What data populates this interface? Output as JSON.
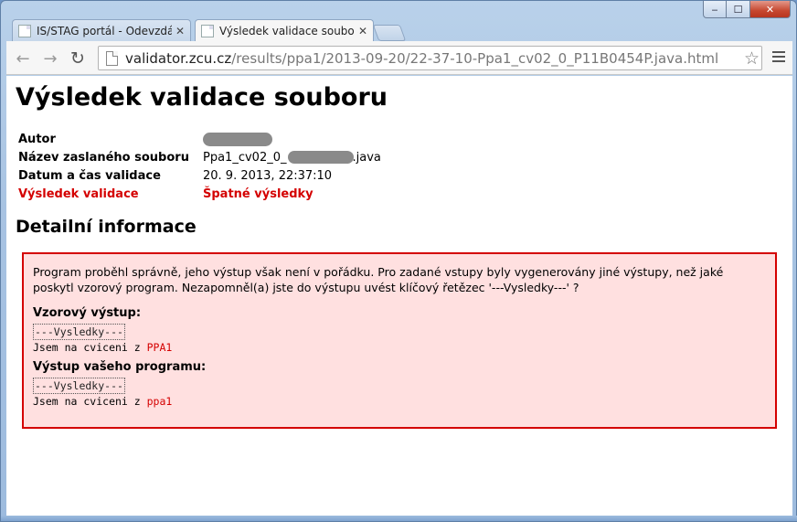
{
  "window": {
    "controls": {
      "minimize": "‒",
      "maximize": "☐",
      "close": "✕"
    }
  },
  "tabs": [
    {
      "label": "IS/STAG portál - Odevzdáv",
      "close": "✕"
    },
    {
      "label": "Výsledek validace souboru",
      "close": "✕"
    }
  ],
  "toolbar": {
    "url_host": "validator.zcu.cz",
    "url_path": "/results/ppa1/2013-09-20/22-37-10-Ppa1_cv02_0_P11B0454P.java.html"
  },
  "page": {
    "title": "Výsledek validace souboru",
    "info": {
      "author_label": "Autor",
      "filename_label": "Název zaslaného souboru",
      "filename_prefix": "Ppa1_cv02_0_",
      "filename_suffix": ".java",
      "datetime_label": "Datum a čas validace",
      "datetime_value": "20. 9. 2013, 22:37:10",
      "result_label": "Výsledek validace",
      "result_value": "Špatné výsledky"
    },
    "detail_heading": "Detailní informace",
    "detail": {
      "message": "Program proběhl správně, jeho výstup však není v pořádku. Pro zadané vstupy byly vygenerovány jiné výstupy, než jaké poskytl vzorový program. Nezapomněl(a) jste do výstupu uvést klíčový řetězec '---Vysledky---' ?",
      "expected_label": "Vzorový výstup:",
      "expected_header": "---Vysledky---",
      "expected_line_prefix": "Jsem na cviceni z ",
      "expected_line_highlight": "PPA1",
      "actual_label": "Výstup vašeho programu:",
      "actual_header": "---Vysledky---",
      "actual_line_prefix": "Jsem na cviceni z ",
      "actual_line_highlight": "ppa1"
    }
  },
  "colors": {
    "error_red": "#d40000",
    "detail_background": "#ffe0e0"
  }
}
